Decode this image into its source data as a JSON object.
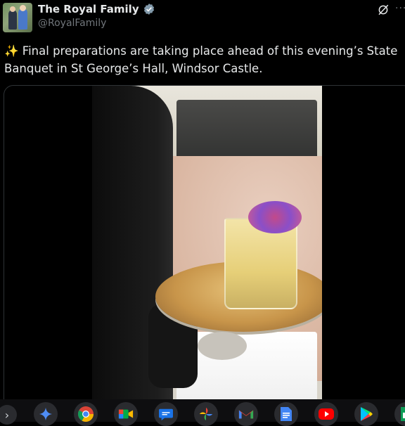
{
  "account": {
    "display_name": "The Royal Family",
    "handle": "@RoyalFamily",
    "verified_color": "#829aab"
  },
  "tweet": {
    "emoji": "✨",
    "text": "Final preparations are taking place ahead of this evening’s State Banquet in St George’s Hall, Windsor Castle."
  },
  "header_icons": {
    "grok": "grok-icon",
    "more": "···"
  },
  "dock": {
    "chevron": "›",
    "apps": [
      "gemini-icon",
      "chrome-icon",
      "meet-icon",
      "messages-icon",
      "photos-icon",
      "gmail-icon",
      "docs-icon",
      "youtube-icon",
      "play-store-icon",
      "sheets-icon"
    ]
  }
}
